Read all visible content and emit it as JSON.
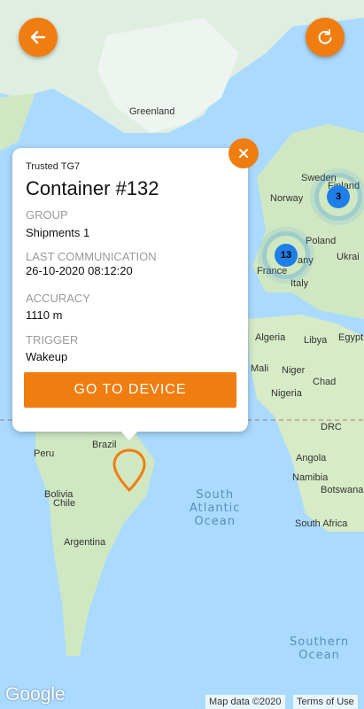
{
  "map": {
    "labels": {
      "greenland": "Greenland",
      "sweden": "Sweden",
      "finland": "Finland",
      "norway": "Norway",
      "poland": "Poland",
      "france": "France",
      "ukraine": "Ukrai",
      "italy": "Italy",
      "algeria": "Algeria",
      "libya": "Libya",
      "egypt": "Egypt",
      "mali": "Mali",
      "niger": "Niger",
      "chad": "Chad",
      "nigeria": "Nigeria",
      "drc": "DRC",
      "angola": "Angola",
      "namibia": "Namibia",
      "botswana": "Botswana",
      "south_africa": "South Africa",
      "brazil": "Brazil",
      "peru": "Peru",
      "bolivia": "Bolivia",
      "chile": "Chile",
      "argentina": "Argentina",
      "any": "any"
    },
    "oceans": {
      "south_atlantic": "South\nAtlantic\nOcean",
      "southern": "Southern\nOcean"
    },
    "clusters": [
      {
        "count": "3"
      },
      {
        "count": "13"
      }
    ],
    "google_logo": "Google",
    "attribution": {
      "map_data": "Map data ©2020",
      "terms": "Terms of Use"
    }
  },
  "toolbar": {
    "back_icon": "arrow-left-icon",
    "refresh_icon": "refresh-icon"
  },
  "popup": {
    "device_type": "Trusted TG7",
    "title": "Container #132",
    "group_label": "GROUP",
    "group_value": "Shipments 1",
    "last_comm_label": "LAST COMMUNICATION",
    "last_comm_value": "26-10-2020 08:12:20",
    "accuracy_label": "ACCURACY",
    "accuracy_value": "1110 m",
    "trigger_label": "TRIGGER",
    "trigger_value": "Wakeup",
    "button_label": "GO TO DEVICE",
    "close_icon": "close-icon"
  },
  "colors": {
    "accent": "#f07d0f",
    "water": "#aadaff",
    "land": "#cfe8c2",
    "cluster": "#1f7ee8"
  }
}
